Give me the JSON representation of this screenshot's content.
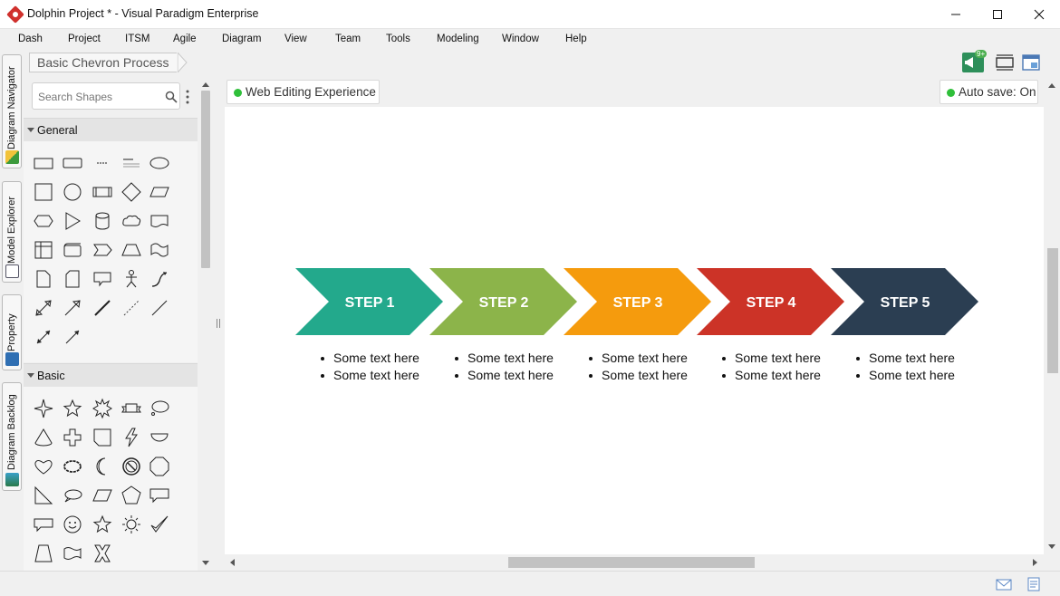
{
  "window": {
    "title": "Dolphin Project * - Visual Paradigm Enterprise"
  },
  "menu": [
    "Dash",
    "Project",
    "ITSM",
    "Agile",
    "Diagram",
    "View",
    "Team",
    "Tools",
    "Modeling",
    "Window",
    "Help"
  ],
  "side_tabs": [
    "Diagram Navigator",
    "Model Explorer",
    "Property",
    "Diagram Backlog"
  ],
  "breadcrumb": "Basic Chevron Process",
  "toolbar": {
    "notification_badge": "9+"
  },
  "shapes_panel": {
    "search_placeholder": "Search Shapes",
    "categories": [
      "General",
      "Basic"
    ]
  },
  "canvas": {
    "web_editing_label": "Web Editing Experience",
    "autosave_label": "Auto save: On",
    "steps": [
      {
        "label": "STEP 1",
        "color": "#23a98c",
        "bullets": [
          "Some text here",
          "Some text here"
        ]
      },
      {
        "label": "STEP 2",
        "color": "#8cb44a",
        "bullets": [
          "Some text here",
          "Some text here"
        ]
      },
      {
        "label": "STEP 3",
        "color": "#f59b0d",
        "bullets": [
          "Some text here",
          "Some text here"
        ]
      },
      {
        "label": "STEP 4",
        "color": "#cc3327",
        "bullets": [
          "Some text here",
          "Some text here"
        ]
      },
      {
        "label": "STEP 5",
        "color": "#2b3e52",
        "bullets": [
          "Some text here",
          "Some text here"
        ]
      }
    ]
  }
}
